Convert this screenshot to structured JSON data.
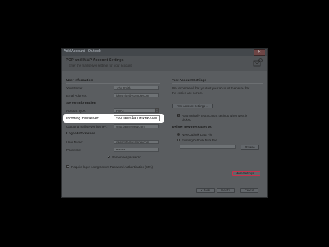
{
  "window": {
    "title": "Add Account - Outlook",
    "close_glyph": "✕"
  },
  "header": {
    "title": "POP and IMAP Account Settings",
    "subtitle": "Enter the mail server settings for your account."
  },
  "user_information": {
    "heading": "User Information",
    "your_name_label": "Your Name:",
    "your_name_value": "John Smith",
    "email_label": "Email Address:",
    "email_value": "johnsmith@example.com"
  },
  "server_information": {
    "heading": "Server Information",
    "account_type_label": "Account Type:",
    "account_type_value": "POP3",
    "incoming_label": "Incoming mail server:",
    "incoming_value": "yourname.bannerview.com",
    "outgoing_label": "Outgoing mail server (SMTP):",
    "outgoing_value": "smtp.bannerview.com"
  },
  "logon_information": {
    "heading": "Logon Information",
    "user_name_label": "User Name:",
    "user_name_value": "johnsmith@example.com",
    "password_label": "Password:",
    "password_value": "********",
    "remember_label": "Remember password",
    "remember_checked": true,
    "spa_label": "Require logon using Secure Password Authentication (SPA)",
    "spa_checked": false
  },
  "test_settings": {
    "heading": "Test Account Settings",
    "description_line1": "We recommend that you test your account to ensure that",
    "description_line2": "the entries are correct.",
    "test_button": "Test Account Settings ...",
    "auto_test_line1": "Automatically test account settings when Next is",
    "auto_test_line2": "clicked",
    "auto_test_checked": true
  },
  "deliver": {
    "heading": "Deliver new messages to:",
    "option_new": "New Outlook Data File",
    "option_existing": "Existing Outlook Data File",
    "selected": "new",
    "browse_button": "Browse"
  },
  "more_settings_button": "More Settings ...",
  "footer": {
    "back": "< Back",
    "next": "Next >",
    "cancel": "Cancel"
  }
}
